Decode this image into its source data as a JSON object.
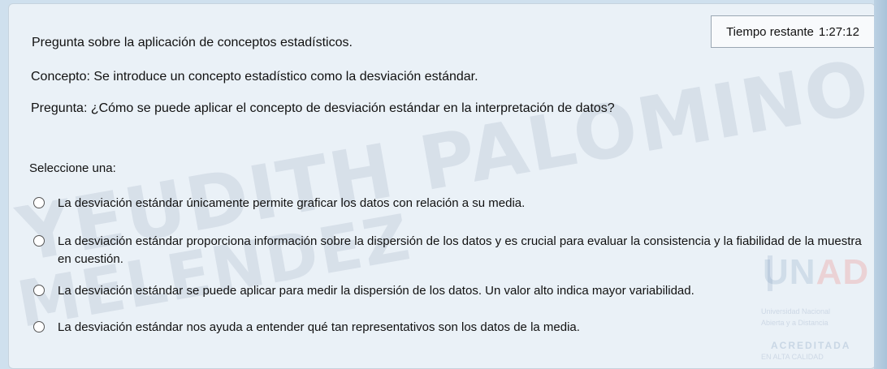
{
  "timer": {
    "label": "Tiempo restante",
    "value": "1:27:12"
  },
  "question": {
    "header": "Pregunta sobre la aplicación de conceptos estadísticos.",
    "concept": "Concepto: Se introduce un concepto estadístico como la desviación estándar.",
    "prompt": "Pregunta: ¿Cómo se puede aplicar el concepto de desviación estándar en la interpretación de datos?",
    "select_label": "Seleccione una:"
  },
  "options": [
    {
      "text": "La desviación estándar únicamente permite graficar los datos con relación a su media.",
      "selected": false
    },
    {
      "text": "La desviación estándar proporciona información sobre la dispersión de los datos y es crucial para evaluar la consistencia y la fiabilidad de la muestra en cuestión.",
      "selected": false
    },
    {
      "text": "La desviación estándar se puede aplicar para medir la dispersión de los datos. Un valor alto indica mayor variabilidad.",
      "selected": false
    },
    {
      "text": "La desviación estándar nos ayuda a entender qué tan representativos son los datos de la media.",
      "selected": false
    }
  ],
  "watermark": {
    "line1": "YEUDITH PALOMINO",
    "line2": "MELENDEZ"
  },
  "logo": {
    "mark_main": "UN",
    "mark_accent": "AD",
    "line1": "Universidad Nacional",
    "line2": "Abierta y a Distancia",
    "seal": "ACREDITADA",
    "line3": "EN ALTA CALIDAD"
  }
}
